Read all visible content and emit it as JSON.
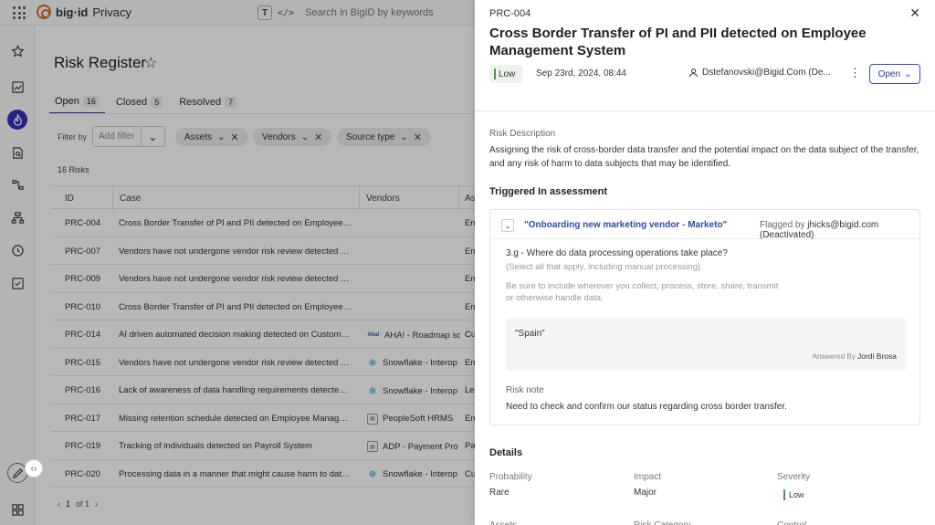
{
  "topbar": {
    "brand": "big·id",
    "product": "Privacy",
    "search_placeholder": "Search in BigID by keywords",
    "search_mode_icon": "text-icon",
    "code_icon": "</>"
  },
  "page": {
    "title": "Risk Register",
    "tabs": [
      {
        "label": "Open",
        "count": "16"
      },
      {
        "label": "Closed",
        "count": "5"
      },
      {
        "label": "Resolved",
        "count": "7"
      }
    ],
    "filter_by": "Filter by",
    "add_filter": "Add filter",
    "chips": [
      "Assets",
      "Vendors",
      "Source type"
    ],
    "risk_count": "16 Risks",
    "columns": {
      "id": "ID",
      "case": "Case",
      "vendors": "Vendors",
      "as": "As"
    },
    "rows": [
      {
        "id": "PRC-004",
        "case": "Cross Border Transfer of PI and PII detected on Employee Ma...",
        "vendor": "",
        "as": "Em"
      },
      {
        "id": "PRC-007",
        "case": "Vendors have not undergone vendor risk review detected on ...",
        "vendor": "",
        "as": "Em"
      },
      {
        "id": "PRC-009",
        "case": "Vendors have not undergone vendor risk review detected on ...",
        "vendor": "",
        "as": "Em"
      },
      {
        "id": "PRC-010",
        "case": "Cross Border Transfer of PI and PII detected on Employee Ma...",
        "vendor": "",
        "as": "Em"
      },
      {
        "id": "PRC-014",
        "case": "AI driven automated decision making detected on Customer ...",
        "vendor": "AHA! - Roadmap sc",
        "vendor_icon": "aha",
        "as": "Cu"
      },
      {
        "id": "PRC-015",
        "case": "Vendors have not undergone vendor risk review detected on ...",
        "vendor": "Snowflake - Interop",
        "vendor_icon": "snowflake",
        "as": "Em"
      },
      {
        "id": "PRC-016",
        "case": "Lack of awareness of data handling requirements detected o...",
        "vendor": "Snowflake - Interop",
        "vendor_icon": "snowflake",
        "as": "Le"
      },
      {
        "id": "PRC-017",
        "case": "Missing retention schedule detected on Employee Manageme...",
        "vendor": "PeopleSoft HRMS",
        "vendor_icon": "doc",
        "as": "Em"
      },
      {
        "id": "PRC-019",
        "case": "Tracking of individuals detected on Payroll System",
        "vendor": "ADP - Payment Pro",
        "vendor_icon": "doc",
        "as": "Pa"
      },
      {
        "id": "PRC-020",
        "case": "Processing data in a manner that might cause harm to data ...",
        "vendor": "Snowflake - Interop",
        "vendor_icon": "snowflake",
        "as": "Cu"
      }
    ],
    "pagination": {
      "current": "1",
      "of": "of 1"
    },
    "aha_glyph": "Aha!"
  },
  "drawer": {
    "id": "PRC-004",
    "title": "Cross Border Transfer of PI and PII detected on Employee Management System",
    "severity": "Low",
    "date": "Sep 23rd, 2024, 08:44",
    "owner": "Dstefanovski@Bigid.Com (De...",
    "status": "Open",
    "risk_description_label": "Risk Description",
    "risk_description": "Assigning the risk of cross-border data transfer and the potential impact on the data subject of the transfer, and any risk of harm to data subjects that may be identified.",
    "triggered_heading": "Triggered In assessment",
    "assessment": {
      "name": "\"Onboarding new marketing vendor - Marketo\"",
      "flagged_by_label": "Flagged by",
      "flagged_by": "jhicks@bigid.com (Deactivated)",
      "question": "3.g - Where do data processing operations take place?",
      "question_hint": "(Select all that apply, including manual processing)",
      "question_help": "Be sure to include wherever you collect, process, store, share, transmit or otherwise handle data.",
      "answer": "\"Spain\"",
      "answered_by_label": "Answered By",
      "answered_by": "Jordi Brosa",
      "risk_note_label": "Risk note",
      "risk_note": "Need to check and confirm our status regarding cross border transfer."
    },
    "details": {
      "heading": "Details",
      "probability_label": "Probability",
      "probability": "Rare",
      "impact_label": "Impact",
      "impact": "Major",
      "severity_label": "Severity",
      "severity": "Low",
      "row2_labels": [
        "Assets",
        "Risk Category",
        "Control"
      ]
    }
  },
  "colors": {
    "accent": "#3a2fbf",
    "link": "#2a4ab0",
    "low_severity": "#3c9a4a",
    "logo": "#d96b2b"
  }
}
